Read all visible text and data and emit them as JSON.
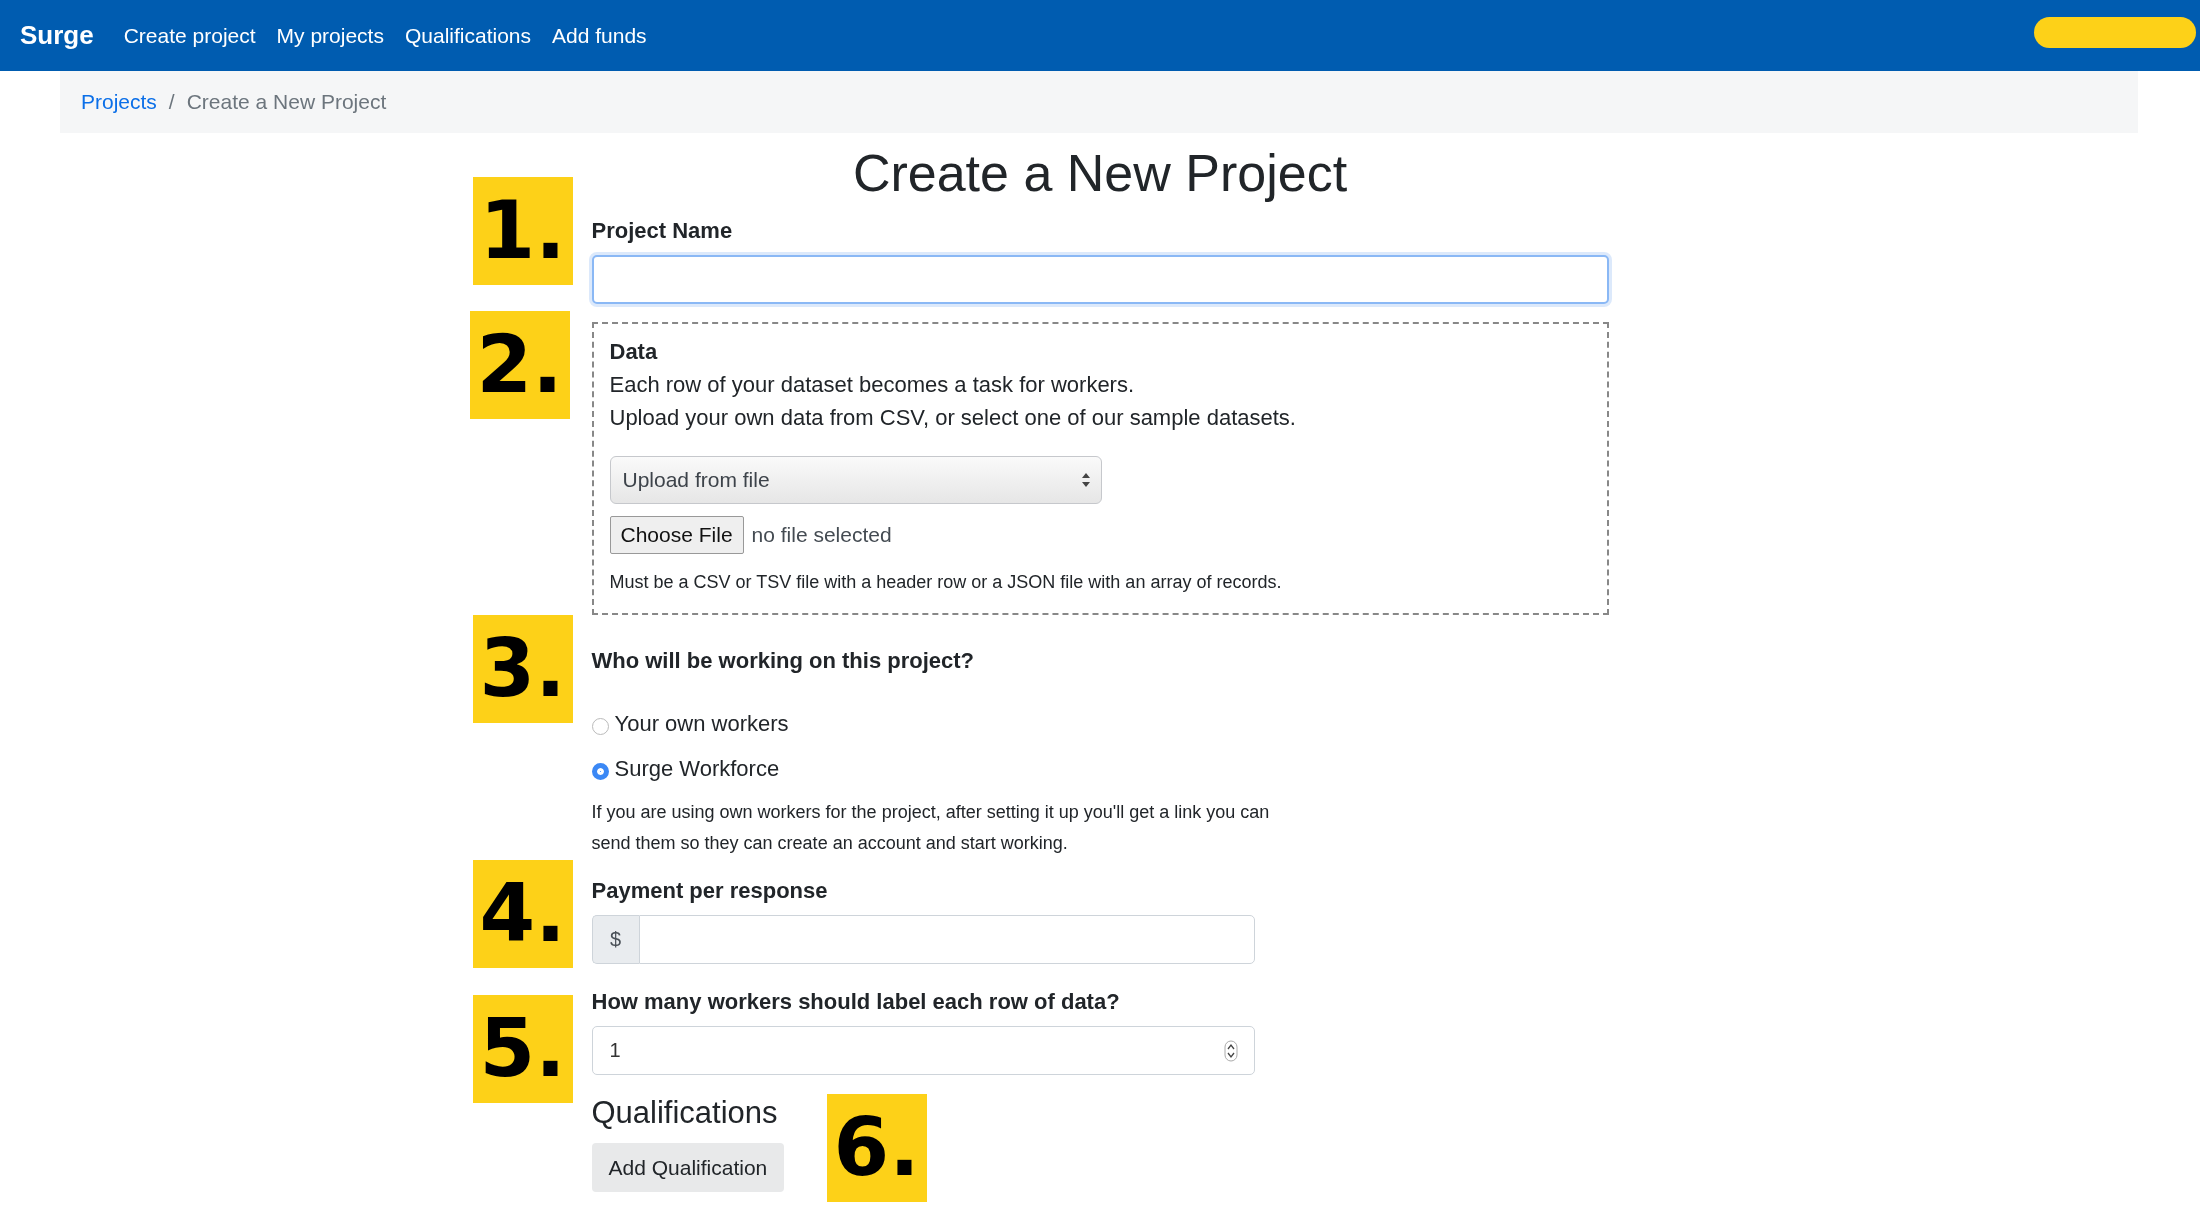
{
  "navbar": {
    "brand": "Surge",
    "links": [
      "Create project",
      "My projects",
      "Qualifications",
      "Add funds"
    ]
  },
  "breadcrumb": {
    "items": [
      {
        "label": "Projects",
        "kind": "link"
      },
      {
        "label": "Create a New Project",
        "kind": "current"
      }
    ],
    "separator": "/"
  },
  "title": "Create a New Project",
  "project_name": {
    "marker": "1.",
    "label": "Project Name"
  },
  "data": {
    "marker": "2.",
    "label": "Data",
    "lines": [
      "Each row of your dataset becomes a task for workers.",
      "Upload your own data from CSV, or select one of our sample datasets."
    ],
    "source_select": "Upload from file",
    "file_button": "Choose File",
    "file_status": "no file selected",
    "help": "Must be a CSV or TSV file with a header row or a JSON file with an array of records."
  },
  "workers": {
    "marker": "3.",
    "label": "Who will be working on this project?",
    "options": [
      {
        "label": "Your own workers",
        "selected": false
      },
      {
        "label": "Surge Workforce",
        "selected": true
      }
    ],
    "help": "If you are using own workers for the project, after setting it up you'll get a link you can send them so they can create an account and start working."
  },
  "payment": {
    "marker": "4.",
    "label": "Payment per response",
    "prefix": "$"
  },
  "workers_per_row": {
    "marker": "5.",
    "label": "How many workers should label each row of data?",
    "value": "1"
  },
  "qualifications": {
    "marker": "6.",
    "heading": "Qualifications",
    "button": "Add Qualification"
  }
}
